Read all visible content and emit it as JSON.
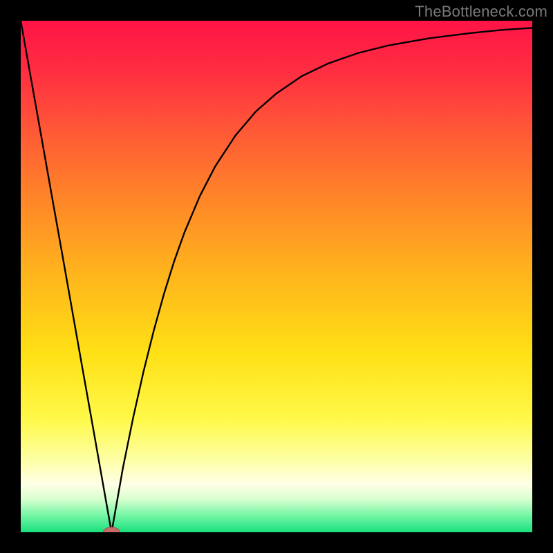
{
  "watermark": "TheBottleneck.com",
  "colors": {
    "frame": "#000000",
    "curve": "#000000",
    "marker_fill": "#c66a6a",
    "marker_stroke": "#a64d4d",
    "gradient_stops": [
      {
        "offset": 0.0,
        "color": "#ff1446"
      },
      {
        "offset": 0.1,
        "color": "#ff2e41"
      },
      {
        "offset": 0.22,
        "color": "#ff5a36"
      },
      {
        "offset": 0.35,
        "color": "#ff8628"
      },
      {
        "offset": 0.5,
        "color": "#ffb61c"
      },
      {
        "offset": 0.65,
        "color": "#ffe015"
      },
      {
        "offset": 0.78,
        "color": "#fff94a"
      },
      {
        "offset": 0.86,
        "color": "#fdffa6"
      },
      {
        "offset": 0.905,
        "color": "#ffffe6"
      },
      {
        "offset": 0.935,
        "color": "#d9ffcf"
      },
      {
        "offset": 0.965,
        "color": "#7bf7a8"
      },
      {
        "offset": 1.0,
        "color": "#18e07e"
      }
    ]
  },
  "chart_data": {
    "type": "line",
    "x": [
      0.0,
      0.02,
      0.04,
      0.06,
      0.08,
      0.1,
      0.12,
      0.14,
      0.16,
      0.1775,
      0.18,
      0.1825,
      0.2,
      0.22,
      0.24,
      0.26,
      0.28,
      0.3,
      0.32,
      0.35,
      0.38,
      0.42,
      0.46,
      0.5,
      0.55,
      0.6,
      0.66,
      0.72,
      0.8,
      0.88,
      0.94,
      1.0
    ],
    "values": [
      1.0,
      0.887,
      0.775,
      0.662,
      0.55,
      0.437,
      0.324,
      0.212,
      0.099,
      0.0,
      0.014,
      0.028,
      0.127,
      0.225,
      0.314,
      0.394,
      0.466,
      0.53,
      0.586,
      0.657,
      0.715,
      0.776,
      0.823,
      0.858,
      0.892,
      0.916,
      0.937,
      0.952,
      0.966,
      0.976,
      0.982,
      0.986
    ],
    "title": "",
    "xlabel": "",
    "ylabel": "",
    "xlim": [
      0,
      1
    ],
    "ylim": [
      0,
      1
    ],
    "marker": {
      "x": 0.1775,
      "y": 0.0,
      "rx": 0.016,
      "ry": 0.01
    }
  }
}
